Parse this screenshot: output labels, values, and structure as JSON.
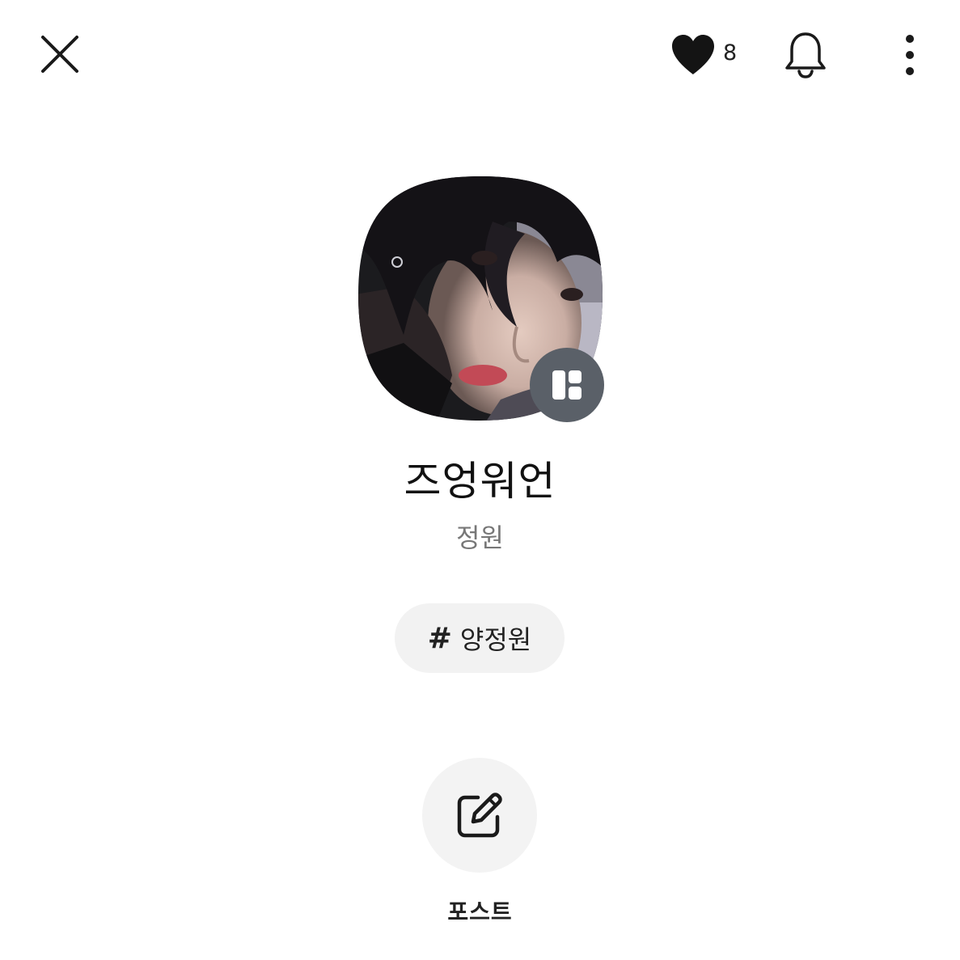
{
  "header": {
    "close_icon": "close-icon",
    "like_icon": "heart-icon",
    "like_count": "8",
    "notification_icon": "bell-icon",
    "more_icon": "more-vertical-icon"
  },
  "profile": {
    "avatar_icon": "profile-photo",
    "badge_icon": "layout-icon",
    "name": "즈엉워언",
    "subtitle": "정원",
    "tag": {
      "hash": "#",
      "label": "양정원"
    }
  },
  "actions": {
    "post_icon": "edit-icon",
    "post_label": "포스트"
  },
  "colors": {
    "background": "#ffffff",
    "text_primary": "#111111",
    "text_secondary": "#777777",
    "chip_bg": "#f2f2f2",
    "badge_bg": "#5a6068"
  }
}
